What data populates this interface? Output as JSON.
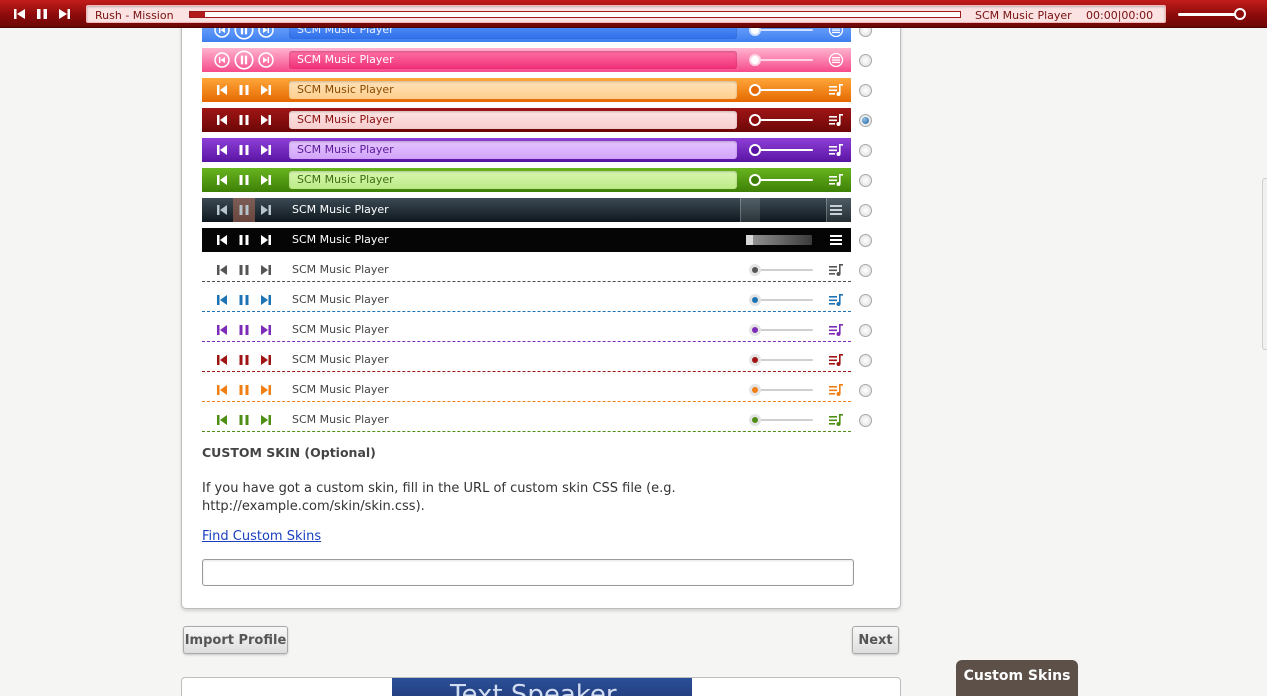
{
  "topbar": {
    "track": "Rush - Mission",
    "title": "SCM Music Player",
    "time": "00:00|00:00",
    "progress": 0.02,
    "volume": 1.0
  },
  "skins": [
    {
      "label": "SCM Music Player",
      "style": "blue-glossy",
      "selected": false
    },
    {
      "label": "SCM Music Player",
      "style": "pink-glossy",
      "selected": false
    },
    {
      "label": "SCM Music Player",
      "style": "orange",
      "selected": false
    },
    {
      "label": "SCM Music Player",
      "style": "darkred",
      "selected": true
    },
    {
      "label": "SCM Music Player",
      "style": "purple",
      "selected": false
    },
    {
      "label": "SCM Music Player",
      "style": "green",
      "selected": false
    },
    {
      "label": "SCM Music Player",
      "style": "dark-glass",
      "selected": false
    },
    {
      "label": "SCM Music Player",
      "style": "black",
      "selected": false
    },
    {
      "label": "SCM Music Player",
      "style": "flat-gray",
      "selected": false
    },
    {
      "label": "SCM Music Player",
      "style": "flat-blue",
      "selected": false
    },
    {
      "label": "SCM Music Player",
      "style": "flat-purple",
      "selected": false
    },
    {
      "label": "SCM Music Player",
      "style": "flat-red",
      "selected": false
    },
    {
      "label": "SCM Music Player",
      "style": "flat-orange",
      "selected": false
    },
    {
      "label": "SCM Music Player",
      "style": "flat-green",
      "selected": false
    }
  ],
  "custom": {
    "heading": "CUSTOM SKIN (Optional)",
    "description": "If you have got a custom skin, fill in the URL of custom skin CSS file (e.g. http://example.com/skin/skin.css).",
    "link": "Find Custom Skins",
    "url_value": ""
  },
  "buttons": {
    "import": "Import Profile",
    "next": "Next"
  },
  "banner_text": "Text Speaker",
  "custom_tab": "Custom Skins",
  "colors": {
    "topbar": "#8d0b0b",
    "selected_radio": "#1f5e9b",
    "link": "#1a3fbf"
  }
}
